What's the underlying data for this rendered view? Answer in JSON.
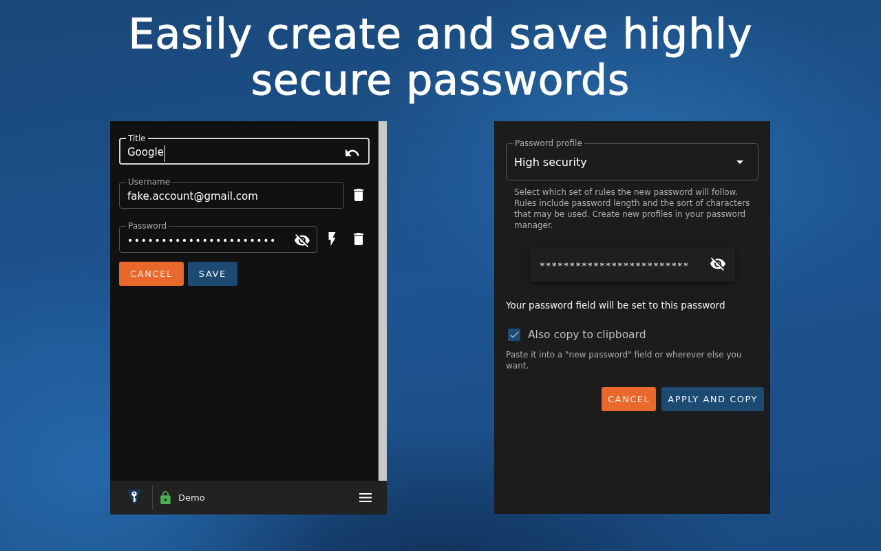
{
  "headline": "Easily create and save highly secure passwords",
  "entry_editor": {
    "fields": [
      {
        "kind": "title",
        "label": "Title",
        "value": "Google",
        "focused": true
      },
      {
        "kind": "username",
        "label": "Username",
        "value": "fake.account@gmail.com",
        "focused": false
      },
      {
        "kind": "password",
        "label": "Password",
        "value": "••••••••••••••••••••••",
        "focused": false
      }
    ],
    "buttons": [
      {
        "kind": "cancel",
        "label": "CANCEL"
      },
      {
        "kind": "save",
        "label": "SAVE"
      }
    ],
    "status_bar": {
      "vault_name": "Demo"
    }
  },
  "password_generator": {
    "profile_select": {
      "label": "Password profile",
      "value": "High security"
    },
    "profile_help": "Select which set of rules the new password will follow. Rules include password length and the sort of characters that may be used. Create new profiles in your password manager.",
    "generated_password": "*************************",
    "apply_note": "Your password field will be set to this password",
    "copy_option": {
      "label": "Also copy to clipboard",
      "checked": true
    },
    "copy_help": "Paste it into a \"new password\" field or wherever else you want.",
    "buttons": [
      {
        "kind": "cancel",
        "label": "CANCEL"
      },
      {
        "kind": "apply",
        "label": "APPLY AND COPY"
      }
    ]
  }
}
